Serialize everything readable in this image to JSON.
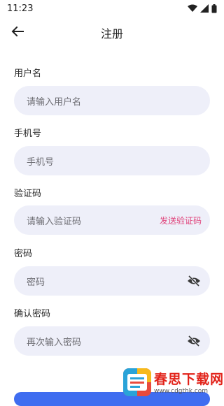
{
  "status_bar": {
    "time": "11:23"
  },
  "app_bar": {
    "title": "注册"
  },
  "form": {
    "username": {
      "label": "用户名",
      "placeholder": "请输入用户名"
    },
    "phone": {
      "label": "手机号",
      "placeholder": "手机号"
    },
    "code": {
      "label": "验证码",
      "placeholder": "请输入验证码",
      "send_label": "发送验证码"
    },
    "password": {
      "label": "密码",
      "placeholder": "密码"
    },
    "confirm": {
      "label": "确认密码",
      "placeholder": "再次输入密码"
    }
  },
  "watermark": {
    "title": "春思下载网",
    "url": "www.cdgthk.com"
  },
  "colors": {
    "field_bg": "#eeeff9",
    "accent_pink": "#e0437b",
    "primary_blue": "#3f6df0"
  },
  "icons": [
    "back-arrow-icon",
    "wifi-icon",
    "signal-icon",
    "battery-icon",
    "eye-off-icon"
  ]
}
